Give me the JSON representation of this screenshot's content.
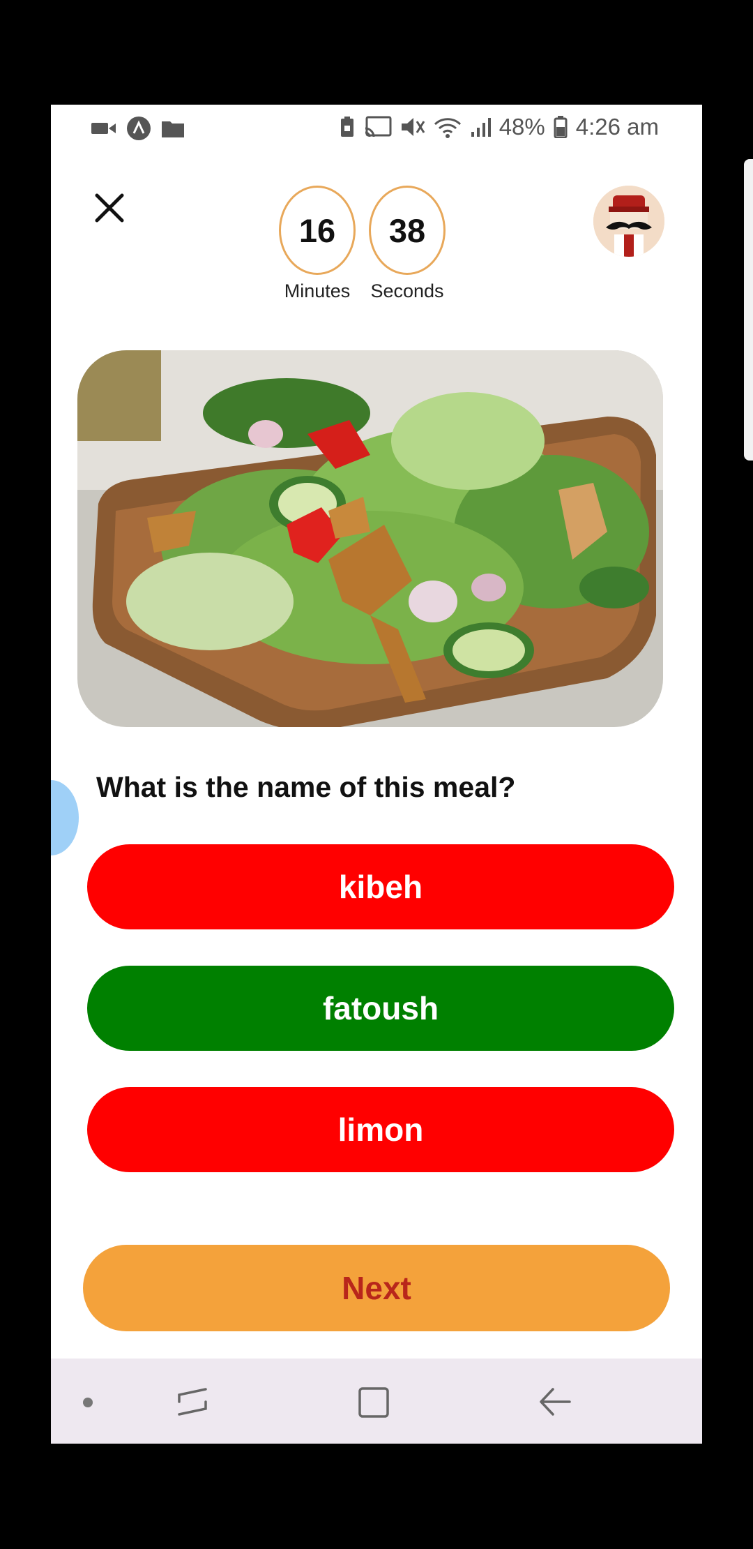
{
  "status_bar": {
    "battery": "48%",
    "time": "4:26 am"
  },
  "timer": {
    "minutes_value": "16",
    "minutes_label": "Minutes",
    "seconds_value": "38",
    "seconds_label": "Seconds",
    "ring_color": "#E8A85A"
  },
  "quiz": {
    "question": "What is the name of this meal?",
    "answers": [
      {
        "label": "kibeh",
        "state": "incorrect",
        "color": "#FF0000"
      },
      {
        "label": "fatoush",
        "state": "correct",
        "color": "#008000"
      },
      {
        "label": "limon",
        "state": "incorrect",
        "color": "#FF0000"
      }
    ],
    "next_label": "Next",
    "next_color": "#F4A23B",
    "next_text_color": "#B8261B"
  },
  "icons": {
    "close": "close-icon",
    "avatar": "chef-avatar-icon",
    "nav_dot": "dot-icon",
    "nav_recents": "recents-icon",
    "nav_home": "home-icon",
    "nav_back": "back-icon"
  }
}
